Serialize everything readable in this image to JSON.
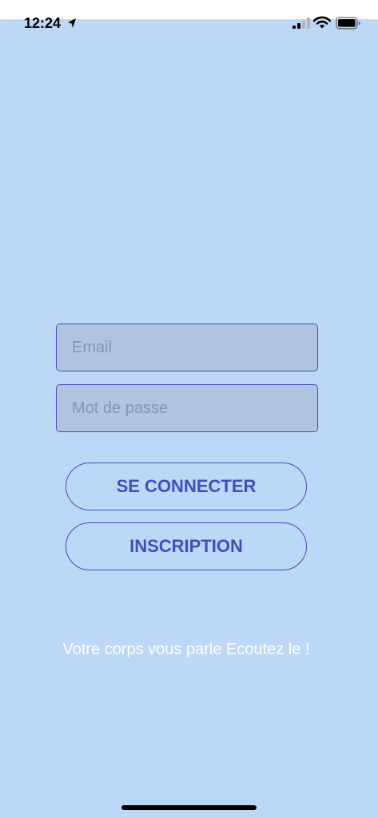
{
  "status_bar": {
    "time": "12:24",
    "icons": [
      "location-arrow-icon",
      "cellular-signal-icon",
      "wifi-icon",
      "battery-icon"
    ]
  },
  "form": {
    "email_placeholder": "Email",
    "password_placeholder": "Mot de passe",
    "email_value": "",
    "password_value": ""
  },
  "buttons": {
    "login_label": "SE CONNECTER",
    "signup_label": "INSCRIPTION"
  },
  "tagline": "Votre corps vous parle Ecoutez le !",
  "colors": {
    "background": "#bdd8f6",
    "input_fill": "#b1c4dd",
    "accent": "#3a4fc4",
    "tagline_text": "#ffffff"
  }
}
